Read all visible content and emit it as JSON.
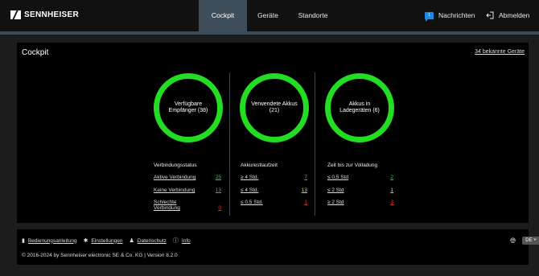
{
  "header": {
    "logo_text": "SENNHEISER",
    "tabs": [
      {
        "label": "Cockpit"
      },
      {
        "label": "Geräte"
      },
      {
        "label": "Standorte"
      }
    ],
    "messages_label": "Nachrichten",
    "messages_badge": "1",
    "logout_label": "Abmelden",
    "accent": "#3d4d59"
  },
  "cockpit": {
    "title": "Cockpit",
    "known_devices_link": "34 bekannte Geräte",
    "ring_color": "#22dd22",
    "circles": [
      {
        "text": "Verfügbare Empfänger (38)"
      },
      {
        "text": "Verwendete Akkus (21)"
      },
      {
        "text": "Akkus in Ladegeräten (6)"
      }
    ],
    "columns": [
      {
        "heading": "Verbindungsstatus",
        "rows": [
          {
            "label": "Aktive Verbindung",
            "value": "25"
          },
          {
            "label": "Keine Verbindung",
            "value": "13"
          },
          {
            "label": "Schlechte Verbindung",
            "value": "0"
          }
        ]
      },
      {
        "heading": "Akkurestlaufzeit",
        "rows": [
          {
            "label": "≥ 4 Std.",
            "value": "7"
          },
          {
            "label": "≤ 4 Std.",
            "value": "13"
          },
          {
            "label": "≤ 0,5 Std.",
            "value": "1"
          }
        ]
      },
      {
        "heading": "Zeit bis zur Volladung",
        "rows": [
          {
            "label": "≤ 0,5 Std",
            "value": "2"
          },
          {
            "label": "≤ 2 Std",
            "value": "1"
          },
          {
            "label": "≥ 2 Std",
            "value": "3"
          }
        ]
      }
    ]
  },
  "footer": {
    "links": [
      {
        "label": "Bedienungsanleitung",
        "icon": "manual-icon"
      },
      {
        "label": "Einstellungen",
        "icon": "settings-icon"
      },
      {
        "label": "Datenschutz",
        "icon": "user-icon"
      },
      {
        "label": "Info",
        "icon": "info-icon"
      }
    ],
    "copyright": "© 2016-2024 by Sennheiser electronic SE & Co. KG | Version 8.2.0",
    "language": "DE"
  }
}
